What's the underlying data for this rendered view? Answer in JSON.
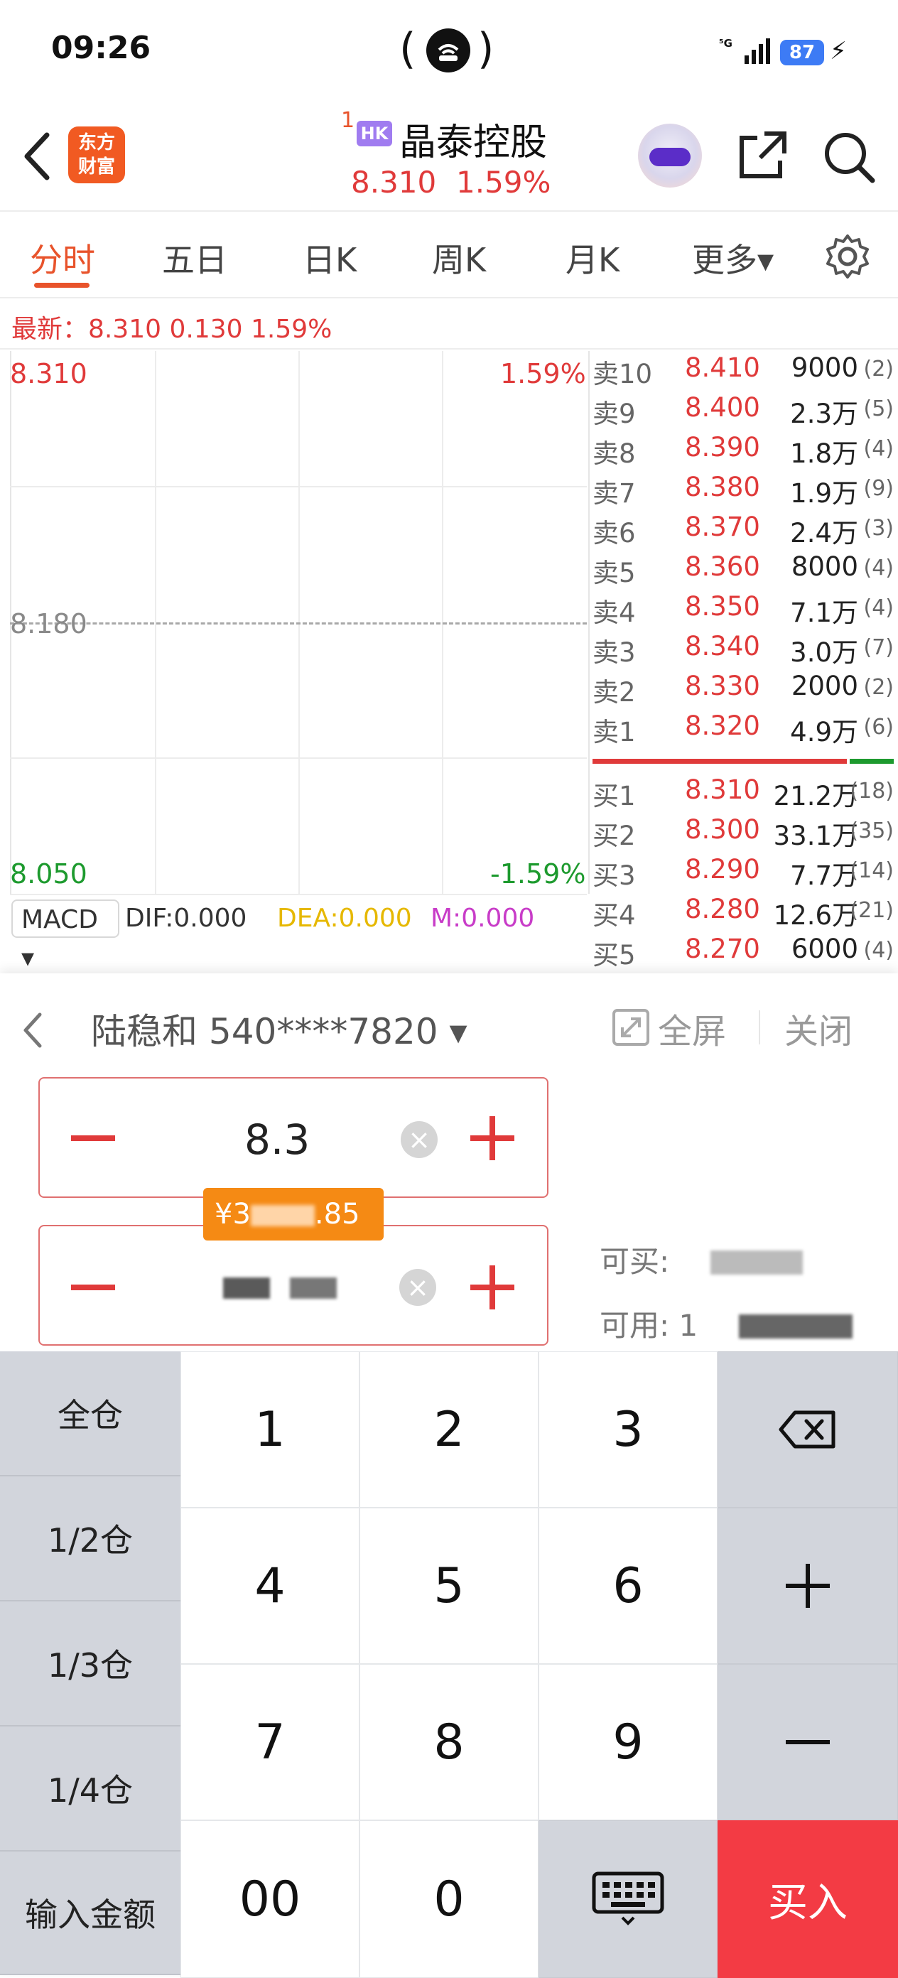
{
  "status_bar": {
    "time": "09:26",
    "battery": "87",
    "signal": "5G"
  },
  "header": {
    "superscript": "1",
    "market_badge": "HK",
    "stock_name": "晶泰控股",
    "price": "8.310",
    "change_pct": "1.59%",
    "logo_line1": "东方",
    "logo_line2": "财富"
  },
  "tabs": [
    {
      "label": "分时"
    },
    {
      "label": "五日"
    },
    {
      "label": "日K"
    },
    {
      "label": "周K"
    },
    {
      "label": "月K"
    },
    {
      "label": "更多▾"
    }
  ],
  "latest_line": "最新：8.310  0.130  1.59%",
  "chart": {
    "top_price": "8.310",
    "top_pct": "1.59%",
    "mid_price": "8.180",
    "bottom_price": "8.050",
    "bottom_pct": "-1.59%"
  },
  "order_book": {
    "asks": [
      {
        "label": "卖10",
        "price": "8.410",
        "volume": "9000",
        "count": "(2)"
      },
      {
        "label": "卖9",
        "price": "8.400",
        "volume": "2.3万",
        "count": "(5)"
      },
      {
        "label": "卖8",
        "price": "8.390",
        "volume": "1.8万",
        "count": "(4)"
      },
      {
        "label": "卖7",
        "price": "8.380",
        "volume": "1.9万",
        "count": "(9)"
      },
      {
        "label": "卖6",
        "price": "8.370",
        "volume": "2.4万",
        "count": "(3)"
      },
      {
        "label": "卖5",
        "price": "8.360",
        "volume": "8000",
        "count": "(4)"
      },
      {
        "label": "卖4",
        "price": "8.350",
        "volume": "7.1万",
        "count": "(4)"
      },
      {
        "label": "卖3",
        "price": "8.340",
        "volume": "3.0万",
        "count": "(7)"
      },
      {
        "label": "卖2",
        "price": "8.330",
        "volume": "2000",
        "count": "(2)"
      },
      {
        "label": "卖1",
        "price": "8.320",
        "volume": "4.9万",
        "count": "(6)"
      }
    ],
    "bids": [
      {
        "label": "买1",
        "price": "8.310",
        "volume": "21.2万",
        "count": "(18)"
      },
      {
        "label": "买2",
        "price": "8.300",
        "volume": "33.1万",
        "count": "(35)"
      },
      {
        "label": "买3",
        "price": "8.290",
        "volume": "7.7万",
        "count": "(14)"
      },
      {
        "label": "买4",
        "price": "8.280",
        "volume": "12.6万",
        "count": "(21)"
      },
      {
        "label": "买5",
        "price": "8.270",
        "volume": "6000",
        "count": "(4)"
      }
    ]
  },
  "macd": {
    "selector": "MACD ▾",
    "dif": "DIF:0.000",
    "dea": "DEA:0.000",
    "m": "M:0.000"
  },
  "trade_panel": {
    "account": "陆稳和 540****7820 ▾",
    "fullscreen": "全屏",
    "close": "关闭",
    "price_value": "8.3",
    "amount_tooltip_prefix": "¥3",
    "amount_tooltip_suffix": ".85",
    "can_buy_label": "可买:",
    "available_label": "可用: 1",
    "buy_label": "买入"
  },
  "keypad": {
    "side": [
      "全仓",
      "1/2仓",
      "1/3仓",
      "1/4仓",
      "输入金额"
    ],
    "keys": [
      "1",
      "2",
      "3",
      "4",
      "5",
      "6",
      "7",
      "8",
      "9",
      "00",
      "0"
    ]
  },
  "colors": {
    "up": "#e03a3a",
    "down": "#1d9a2e",
    "accent": "#e8532b",
    "buy": "#f33b44",
    "tooltip": "#f58a14"
  }
}
